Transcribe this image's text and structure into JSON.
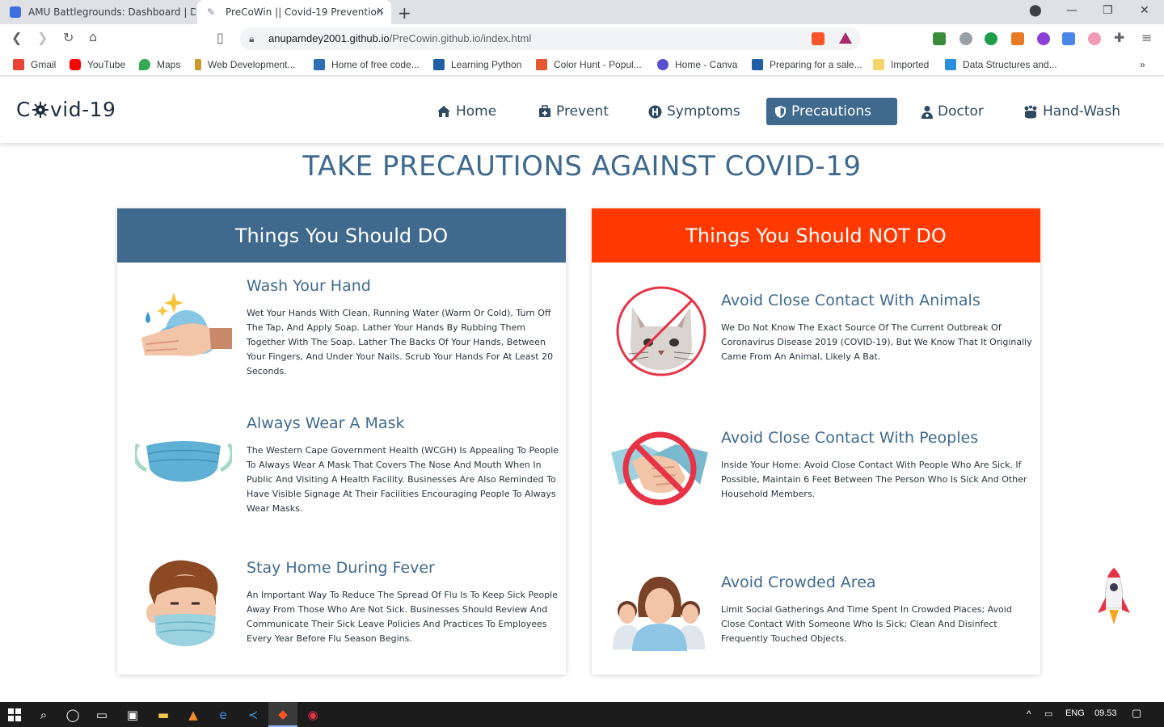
{
  "browser": {
    "tabs": [
      {
        "title": "AMU Battlegrounds: Dashboard | Dev",
        "active": false,
        "color": "#3b6fe0"
      },
      {
        "title": "PreCoWin || Covid-19 Prevention",
        "active": true,
        "color": "#7a7f8a"
      }
    ],
    "url_host": "anupamdey2001.github.io",
    "url_path": "/PreCowin.github.io/index.html",
    "bookmarks": [
      {
        "label": "Gmail",
        "color": "#ea4335"
      },
      {
        "label": "YouTube",
        "color": "#ff0000"
      },
      {
        "label": "Maps",
        "color": "#34a853"
      },
      {
        "label": "Web Development...",
        "color": "#c79b2a"
      },
      {
        "label": "Home of free code...",
        "color": "#2f6fb3"
      },
      {
        "label": "Learning Python",
        "color": "#1f5fa8"
      },
      {
        "label": "Color Hunt - Popul...",
        "color": "#e4572e"
      },
      {
        "label": "Home - Canva",
        "color": "#5a4fd1"
      },
      {
        "label": "Preparing for a sale...",
        "color": "#1f5fa8"
      },
      {
        "label": "Imported",
        "color": "#f5d46b"
      },
      {
        "label": "Data Structures and...",
        "color": "#2b8fe0"
      }
    ]
  },
  "site": {
    "logo_left": "C",
    "logo_right": "vid-19",
    "nav": [
      {
        "label": "Home",
        "icon": "home-icon"
      },
      {
        "label": "Prevent",
        "icon": "medkit-icon"
      },
      {
        "label": "Symptoms",
        "icon": "hospital-icon"
      },
      {
        "label": "Precautions",
        "icon": "shield-icon",
        "active": true
      },
      {
        "label": "Doctor",
        "icon": "doctor-icon"
      },
      {
        "label": "Hand-Wash",
        "icon": "hands-wash-icon"
      }
    ],
    "heading": "TAKE PRECAUTIONS AGAINST COVID-19",
    "do_title": "Things You Should DO",
    "dont_title": "Things You Should NOT DO",
    "do_items": [
      {
        "title": "Wash Your Hand",
        "text": "Wet Your Hands With Clean, Running Water (Warm Or Cold), Turn Off The Tap, And Apply Soap. Lather Your Hands By Rubbing Them Together With The Soap. Lather The Backs Of Your Hands, Between Your Fingers, And Under Your Nails. Scrub Your Hands For At Least 20 Seconds."
      },
      {
        "title": "Always Wear A Mask",
        "text": "The Western Cape Government Health (WCGH) Is Appealing To People To Always Wear A Mask That Covers The Nose And Mouth When In Public And Visiting A Health Facility. Businesses Are Also Reminded To Have Visible Signage At Their Facilities Encouraging People To Always Wear Masks."
      },
      {
        "title": "Stay Home During Fever",
        "text": "An Important Way To Reduce The Spread Of Flu Is To Keep Sick People Away From Those Who Are Not Sick. Businesses Should Review And Communicate Their Sick Leave Policies And Practices To Employees Every Year Before Flu Season Begins."
      }
    ],
    "dont_items": [
      {
        "title": "Avoid Close Contact With Animals",
        "text": "We Do Not Know The Exact Source Of The Current Outbreak Of Coronavirus Disease 2019 (COVID-19), But We Know That It Originally Came From An Animal, Likely A Bat."
      },
      {
        "title": "Avoid Close Contact With Peoples",
        "text": "Inside Your Home: Avoid Close Contact With People Who Are Sick. If Possible, Maintain 6 Feet Between The Person Who Is Sick And Other Household Members."
      },
      {
        "title": "Avoid Crowded Area",
        "text": "Limit Social Gatherings And Time Spent In Crowded Places; Avoid Close Contact With Someone Who Is Sick; Clean And Disinfect Frequently Touched Objects."
      }
    ]
  },
  "taskbar": {
    "lang": "ENG",
    "time": "09.53"
  },
  "colors": {
    "primary": "#3f6a8e",
    "danger": "#ff3900"
  }
}
